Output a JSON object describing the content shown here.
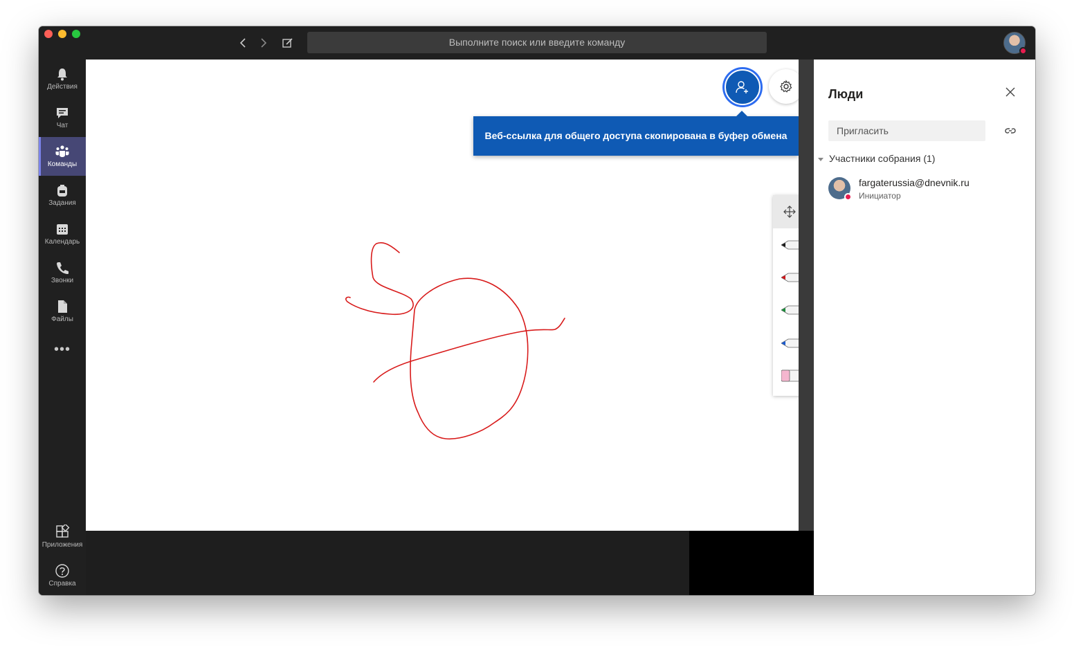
{
  "window": {
    "search_placeholder": "Выполните поиск или введите команду"
  },
  "rail": {
    "items": [
      {
        "label": "Действия",
        "icon": "bell-icon"
      },
      {
        "label": "Чат",
        "icon": "chat-icon"
      },
      {
        "label": "Команды",
        "icon": "teams-icon",
        "active": true
      },
      {
        "label": "Задания",
        "icon": "backpack-icon"
      },
      {
        "label": "Календарь",
        "icon": "calendar-icon"
      },
      {
        "label": "Звонки",
        "icon": "phone-icon"
      },
      {
        "label": "Файлы",
        "icon": "file-icon"
      }
    ],
    "more": "•••",
    "apps_label": "Приложения",
    "help_label": "Справка"
  },
  "whiteboard": {
    "toast_text": "Веб-ссылка для общего доступа скопирована в буфер обмена",
    "ink_color": "#d81a1a",
    "pens": [
      {
        "name": "black-pen",
        "color": "#1a1a1a"
      },
      {
        "name": "red-pen",
        "color": "#d0161a"
      },
      {
        "name": "green-pen",
        "color": "#1a8c3a"
      },
      {
        "name": "blue-pen",
        "color": "#1a5bd0"
      },
      {
        "name": "eraser",
        "color": "#f5b6cf"
      }
    ]
  },
  "people": {
    "title": "Люди",
    "invite_placeholder": "Пригласить",
    "section_label": "Участники собрания",
    "section_count": "(1)",
    "participants": [
      {
        "name": "fargaterussia@dnevnik.ru",
        "role": "Инициатор"
      }
    ]
  },
  "colors": {
    "brand_blue": "#0f5ab4",
    "rail_active": "#464775",
    "presence_busy": "#e81c4f"
  }
}
